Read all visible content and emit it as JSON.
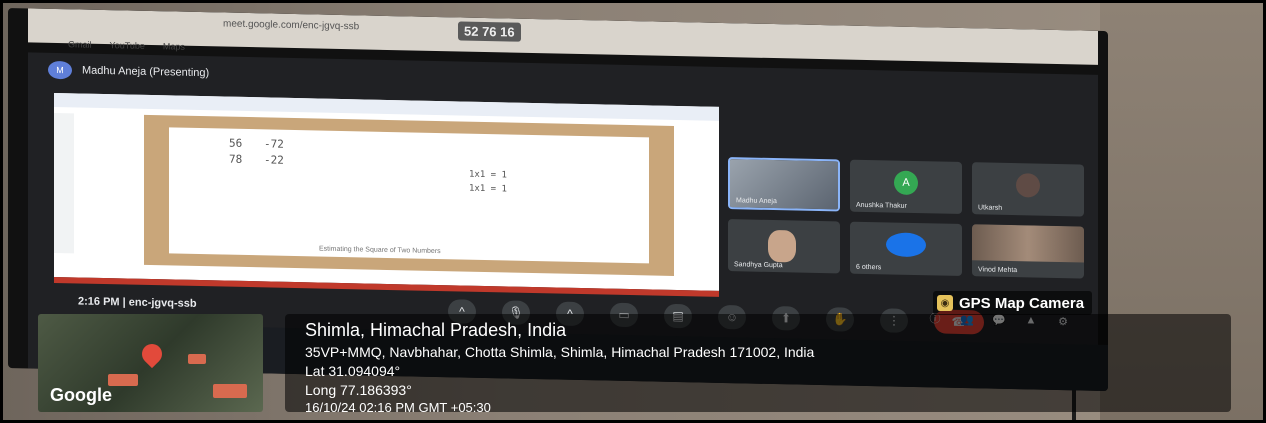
{
  "browser": {
    "address": "meet.google.com/enc-jgvq-ssb",
    "clock_badge": "52 76 16",
    "bookmarks": [
      "Gmail",
      "YouTube",
      "Maps"
    ]
  },
  "meet": {
    "presenter_initial": "M",
    "presenter": "Madhu Aneja (Presenting)",
    "slide_caption": "Estimating the Square of Two Numbers",
    "math_lines": [
      "56",
      "-72",
      "78",
      "-22",
      "1x1 = 1",
      "1x1 = 1"
    ],
    "tiles": [
      {
        "label": "Madhu Aneja",
        "kind": "photo",
        "active": true
      },
      {
        "label": "Anushka Thakur",
        "kind": "avatar",
        "initial": "A"
      },
      {
        "label": "Utkarsh",
        "kind": "avatar-dark"
      },
      {
        "label": "Sandhya Gupta",
        "kind": "face"
      },
      {
        "label": "6 others",
        "kind": "others"
      },
      {
        "label": "Vinod Mehta",
        "kind": "crowd"
      }
    ],
    "meeting_time": "2:16 PM  |  enc-jgvq-ssb",
    "controls": [
      "chevron-up-icon",
      "mic-icon",
      "chevron-up-icon",
      "camera-icon",
      "captions-icon",
      "emoji-icon",
      "present-icon",
      "hand-icon",
      "more-icon",
      "end-call-icon"
    ],
    "control_glyphs": [
      "^",
      "🎙",
      "^",
      "▭",
      "▤",
      "☺",
      "⬆",
      "✋",
      "⋮",
      "☎"
    ],
    "right_icon_glyphs": [
      "ⓘ",
      "👥",
      "💬",
      "▲",
      "⚙"
    ]
  },
  "gps": {
    "tag_label": "GPS Map Camera",
    "title": "Shimla, Himachal Pradesh, India",
    "address": "35VP+MMQ, Navbhahar, Chotta Shimla, Shimla, Himachal Pradesh 171002, India",
    "lat": "Lat 31.094094°",
    "long": "Long 77.186393°",
    "datetime": "16/10/24 02:16 PM GMT +05:30",
    "map_label": "Google"
  }
}
